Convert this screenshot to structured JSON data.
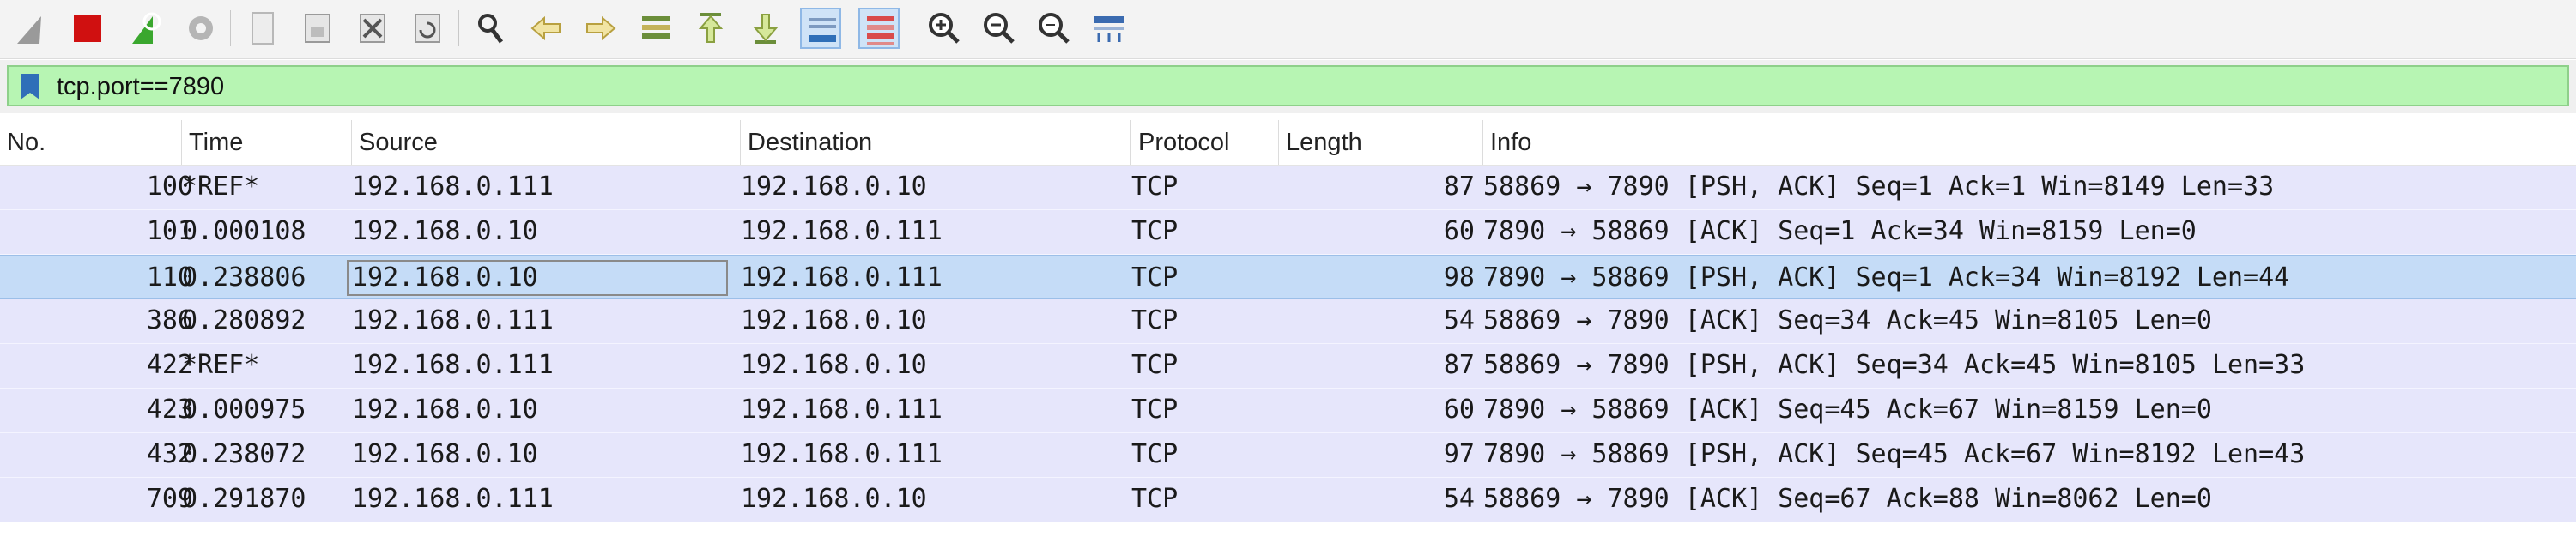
{
  "filter": {
    "value": "tcp.port==7890"
  },
  "columns": [
    "No.",
    "Time",
    "Source",
    "Destination",
    "Protocol",
    "Length",
    "Info"
  ],
  "packets": [
    {
      "no": "100",
      "time": "*REF*",
      "source": "192.168.0.111",
      "destination": "192.168.0.10",
      "protocol": "TCP",
      "length": "87",
      "info": "58869 → 7890 [PSH, ACK] Seq=1 Ack=1 Win=8149 Len=33"
    },
    {
      "no": "101",
      "time": "0.000108",
      "source": "192.168.0.10",
      "destination": "192.168.0.111",
      "protocol": "TCP",
      "length": "60",
      "info": "7890 → 58869 [ACK] Seq=1 Ack=34 Win=8159 Len=0"
    },
    {
      "no": "110",
      "time": "0.238806",
      "source": "192.168.0.10",
      "destination": "192.168.0.111",
      "protocol": "TCP",
      "length": "98",
      "info": "7890 → 58869 [PSH, ACK] Seq=1 Ack=34 Win=8192 Len=44"
    },
    {
      "no": "386",
      "time": "0.280892",
      "source": "192.168.0.111",
      "destination": "192.168.0.10",
      "protocol": "TCP",
      "length": "54",
      "info": "58869 → 7890 [ACK] Seq=34 Ack=45 Win=8105 Len=0"
    },
    {
      "no": "422",
      "time": "*REF*",
      "source": "192.168.0.111",
      "destination": "192.168.0.10",
      "protocol": "TCP",
      "length": "87",
      "info": "58869 → 7890 [PSH, ACK] Seq=34 Ack=45 Win=8105 Len=33"
    },
    {
      "no": "423",
      "time": "0.000975",
      "source": "192.168.0.10",
      "destination": "192.168.0.111",
      "protocol": "TCP",
      "length": "60",
      "info": "7890 → 58869 [ACK] Seq=45 Ack=67 Win=8159 Len=0"
    },
    {
      "no": "432",
      "time": "0.238072",
      "source": "192.168.0.10",
      "destination": "192.168.0.111",
      "protocol": "TCP",
      "length": "97",
      "info": "7890 → 58869 [PSH, ACK] Seq=45 Ack=67 Win=8192 Len=43"
    },
    {
      "no": "709",
      "time": "0.291870",
      "source": "192.168.0.111",
      "destination": "192.168.0.10",
      "protocol": "TCP",
      "length": "54",
      "info": "58869 → 7890 [ACK] Seq=67 Ack=88 Win=8062 Len=0"
    }
  ],
  "selected_row": 2,
  "colors": {
    "filter_valid": "#b7f5b3",
    "row_tcp": "#e6e6fb",
    "row_selected": "#c5dcf7"
  },
  "toolbar_icons": [
    "shark-fin-icon",
    "stop-icon",
    "restart-icon",
    "options-icon",
    "open-icon",
    "save-icon",
    "close-icon",
    "reload-icon",
    "find-icon",
    "back-icon",
    "forward-icon",
    "go-to-packet-icon",
    "first-packet-icon",
    "last-packet-icon",
    "autoscroll-icon",
    "colorize-icon",
    "zoom-in-icon",
    "zoom-out-icon",
    "normal-size-icon",
    "resize-columns-icon"
  ]
}
